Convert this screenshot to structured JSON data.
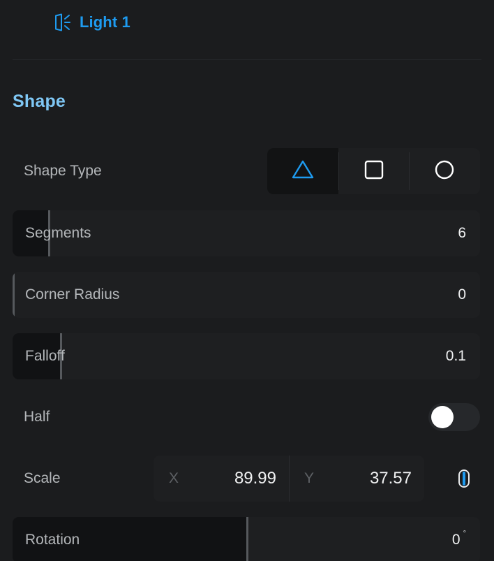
{
  "header": {
    "icon": "light-icon",
    "title": "Light 1",
    "accent_color": "#1e9bf0"
  },
  "section": {
    "title": "Shape",
    "title_color": "#7fc7f5"
  },
  "shape_type": {
    "label": "Shape Type",
    "options": [
      {
        "icon": "triangle-icon",
        "name": "triangle",
        "selected": true
      },
      {
        "icon": "square-icon",
        "name": "square",
        "selected": false
      },
      {
        "icon": "circle-icon",
        "name": "circle",
        "selected": false
      }
    ],
    "selected_color": "#1e9bf0",
    "unselected_color": "#ffffff"
  },
  "sliders": {
    "segments": {
      "label": "Segments",
      "value": "6"
    },
    "corner_radius": {
      "label": "Corner Radius",
      "value": "0"
    },
    "falloff": {
      "label": "Falloff",
      "value": "0.1"
    },
    "rotation": {
      "label": "Rotation",
      "value": "0",
      "unit": "°"
    }
  },
  "half": {
    "label": "Half",
    "state": "off"
  },
  "scale": {
    "label": "Scale",
    "x_axis_label": "X",
    "x_value": "89.99",
    "y_axis_label": "Y",
    "y_value": "37.57",
    "link_icon": "link-icon",
    "link_state": "linked",
    "link_color": "#1e9bf0"
  }
}
